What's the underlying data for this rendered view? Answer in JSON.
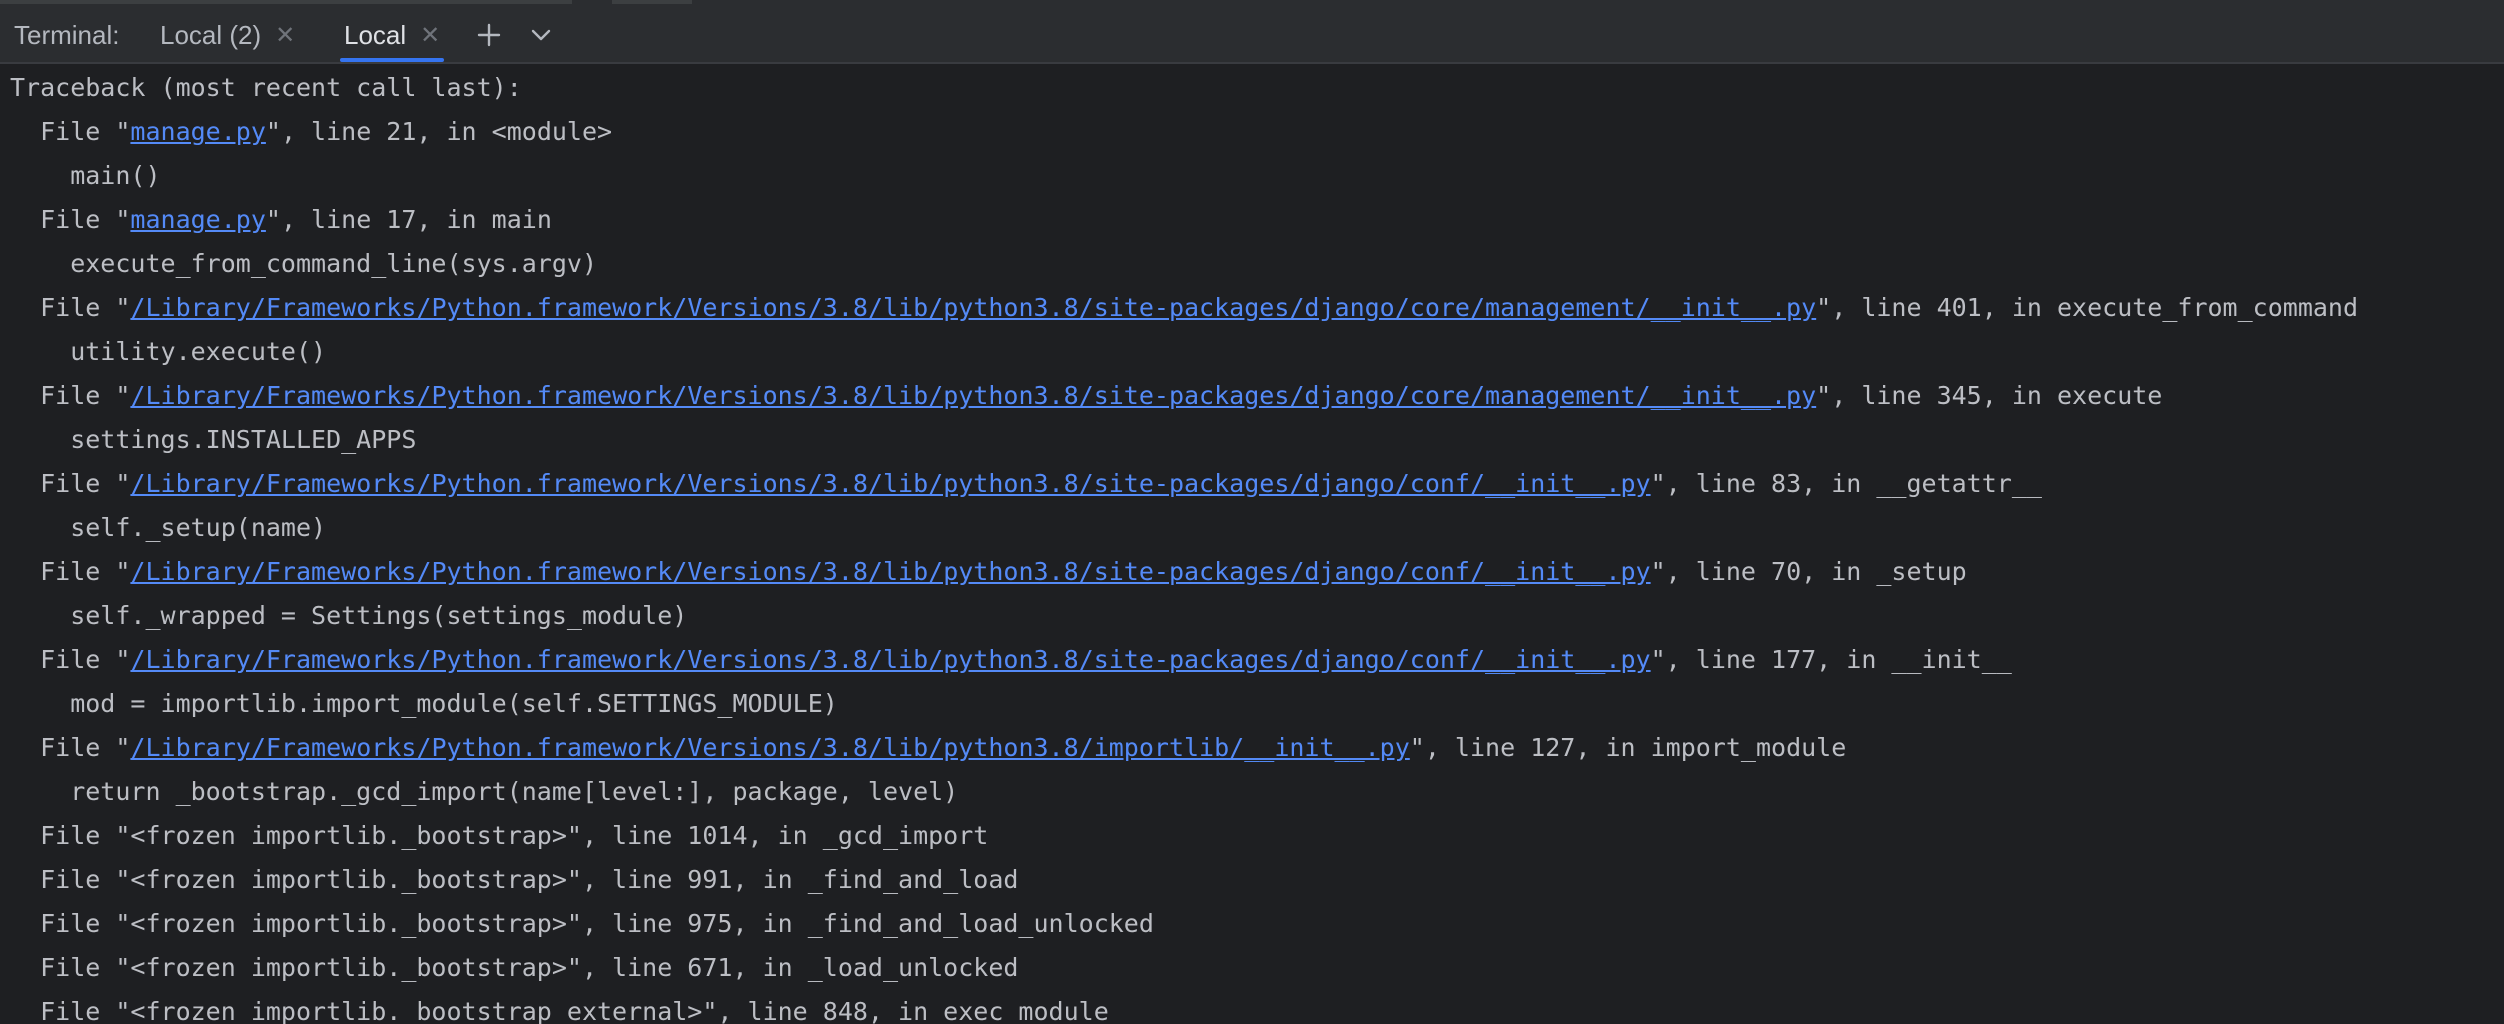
{
  "header": {
    "title": "Terminal:",
    "tabs": [
      {
        "label": "Local (2)"
      },
      {
        "label": "Local"
      }
    ]
  },
  "colors": {
    "background": "#1e1f22",
    "tabbar": "#2b2d30",
    "accent": "#3574f0",
    "link": "#548af7",
    "text": "#bcbec4"
  },
  "icons": [
    "close-icon",
    "plus-icon",
    "chevron-down-icon"
  ],
  "terminal": {
    "lines": [
      {
        "pre": "Traceback (most recent call last):"
      },
      {
        "pre": "  File \"",
        "link": "manage.py",
        "post": "\", line 21, in <module>"
      },
      {
        "pre": "    main()"
      },
      {
        "pre": "  File \"",
        "link": "manage.py",
        "post": "\", line 17, in main"
      },
      {
        "pre": "    execute_from_command_line(sys.argv)"
      },
      {
        "pre": "  File \"",
        "link": "/Library/Frameworks/Python.framework/Versions/3.8/lib/python3.8/site-packages/django/core/management/__init__.py",
        "post": "\", line 401, in execute_from_command"
      },
      {
        "pre": "    utility.execute()"
      },
      {
        "pre": "  File \"",
        "link": "/Library/Frameworks/Python.framework/Versions/3.8/lib/python3.8/site-packages/django/core/management/__init__.py",
        "post": "\", line 345, in execute"
      },
      {
        "pre": "    settings.INSTALLED_APPS"
      },
      {
        "pre": "  File \"",
        "link": "/Library/Frameworks/Python.framework/Versions/3.8/lib/python3.8/site-packages/django/conf/__init__.py",
        "post": "\", line 83, in __getattr__"
      },
      {
        "pre": "    self._setup(name)"
      },
      {
        "pre": "  File \"",
        "link": "/Library/Frameworks/Python.framework/Versions/3.8/lib/python3.8/site-packages/django/conf/__init__.py",
        "post": "\", line 70, in _setup"
      },
      {
        "pre": "    self._wrapped = Settings(settings_module)"
      },
      {
        "pre": "  File \"",
        "link": "/Library/Frameworks/Python.framework/Versions/3.8/lib/python3.8/site-packages/django/conf/__init__.py",
        "post": "\", line 177, in __init__"
      },
      {
        "pre": "    mod = importlib.import_module(self.SETTINGS_MODULE)"
      },
      {
        "pre": "  File \"",
        "link": "/Library/Frameworks/Python.framework/Versions/3.8/lib/python3.8/importlib/__init__.py",
        "post": "\", line 127, in import_module"
      },
      {
        "pre": "    return _bootstrap._gcd_import(name[level:], package, level)"
      },
      {
        "pre": "  File \"<frozen importlib._bootstrap>\", line 1014, in _gcd_import"
      },
      {
        "pre": "  File \"<frozen importlib._bootstrap>\", line 991, in _find_and_load"
      },
      {
        "pre": "  File \"<frozen importlib._bootstrap>\", line 975, in _find_and_load_unlocked"
      },
      {
        "pre": "  File \"<frozen importlib._bootstrap>\", line 671, in _load_unlocked"
      },
      {
        "pre": "  File \"<frozen importlib._bootstrap_external>\", line 848, in exec_module"
      }
    ]
  }
}
